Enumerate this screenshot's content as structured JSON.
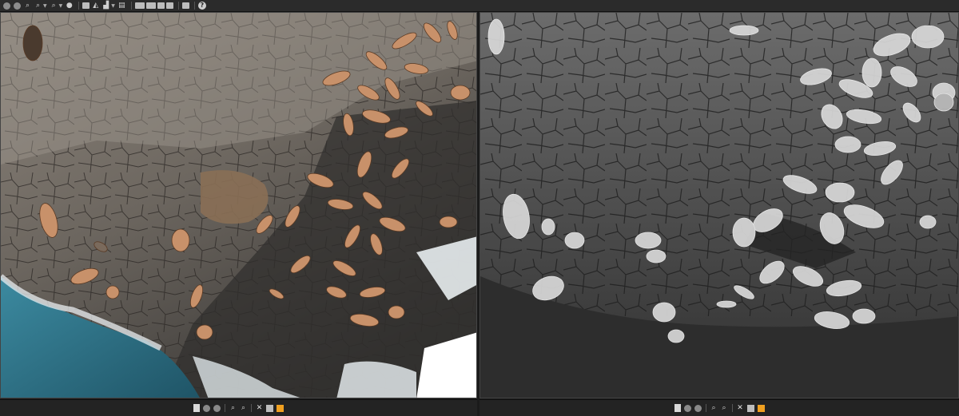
{
  "toolbar": {
    "buttons": [
      {
        "name": "zoom-in-icon"
      },
      {
        "name": "zoom-out-icon"
      },
      {
        "name": "zoom-fit-icon"
      },
      {
        "name": "zoom-actual-icon"
      },
      {
        "name": "zoom-custom-icon"
      },
      {
        "name": "layers-icon"
      },
      {
        "name": "color-balance-icon"
      },
      {
        "name": "panel-icon"
      },
      {
        "name": "contrast-icon"
      },
      {
        "name": "histogram-icon"
      },
      {
        "name": "document-icon"
      },
      {
        "name": "single-view-icon"
      },
      {
        "name": "split-view-icon"
      },
      {
        "name": "compare-view-icon"
      },
      {
        "name": "sync-view-icon"
      },
      {
        "name": "save-view-icon"
      },
      {
        "name": "help-icon"
      }
    ]
  },
  "views": {
    "left": {
      "content": "aerial rgb orthophoto"
    },
    "right": {
      "content": "grayscale processed image"
    }
  },
  "bottom_bars": {
    "icons": [
      "page-icon",
      "dot-icon",
      "dot-icon",
      "zoom-in-icon",
      "zoom-out-icon",
      "close-icon",
      "grid-icon",
      "edit-icon"
    ]
  },
  "colors": {
    "background": "#1b1b1b",
    "toolbar": "#2b2b2b",
    "rock": "#7d7770",
    "dark_rock": "#3d3b39",
    "water": "#2e6e83",
    "sea_lion": "#c8916a",
    "accent_edit": "#f0a020"
  }
}
